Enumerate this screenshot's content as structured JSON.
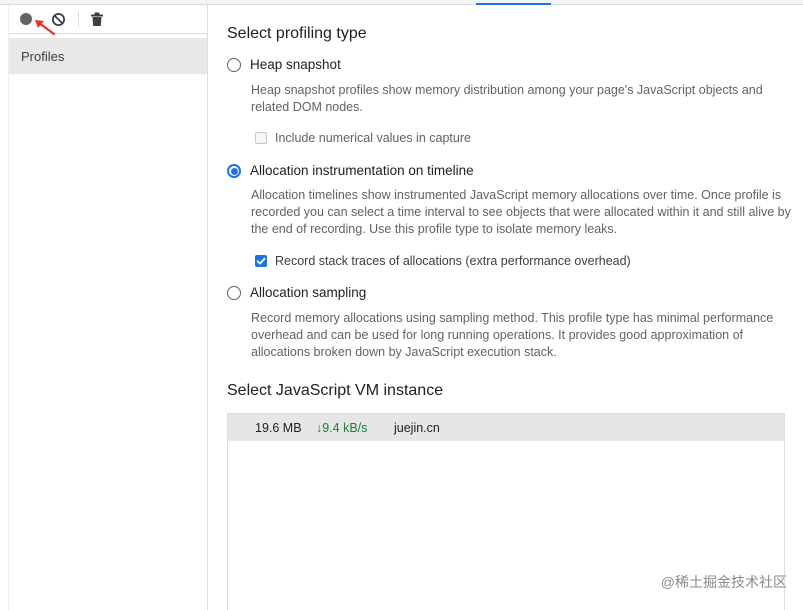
{
  "sidebar": {
    "profiles_label": "Profiles",
    "toolbar": {
      "record_icon": "record-icon",
      "clear_icon": "clear-icon",
      "trash_icon": "trash-icon"
    }
  },
  "main": {
    "profiling_title": "Select profiling type",
    "options": {
      "heap": {
        "label": "Heap snapshot",
        "selected": false,
        "description": "Heap snapshot profiles show memory distribution among your page's JavaScript objects and related DOM nodes.",
        "checkbox_label": "Include numerical values in capture",
        "checkbox_checked": false
      },
      "allocation": {
        "label": "Allocation instrumentation on timeline",
        "selected": true,
        "description": "Allocation timelines show instrumented JavaScript memory allocations over time. Once profile is recorded you can select a time interval to see objects that were allocated within it and still alive by the end of recording. Use this profile type to isolate memory leaks.",
        "checkbox_label": "Record stack traces of allocations (extra performance overhead)",
        "checkbox_checked": true
      },
      "sampling": {
        "label": "Allocation sampling",
        "selected": false,
        "description": "Record memory allocations using sampling method. This profile type has minimal performance overhead and can be used for long running operations. It provides good approximation of allocations broken down by JavaScript execution stack."
      }
    },
    "vm_title": "Select JavaScript VM instance",
    "vm_instances": [
      {
        "size": "19.6 MB",
        "rate": "↓9.4 kB/s",
        "host": "juejin.cn"
      }
    ]
  },
  "watermark": "@稀土掘金技术社区",
  "colors": {
    "accent": "#1a73e8",
    "rate_green": "#188038",
    "annotation_arrow": "#e8312a"
  }
}
